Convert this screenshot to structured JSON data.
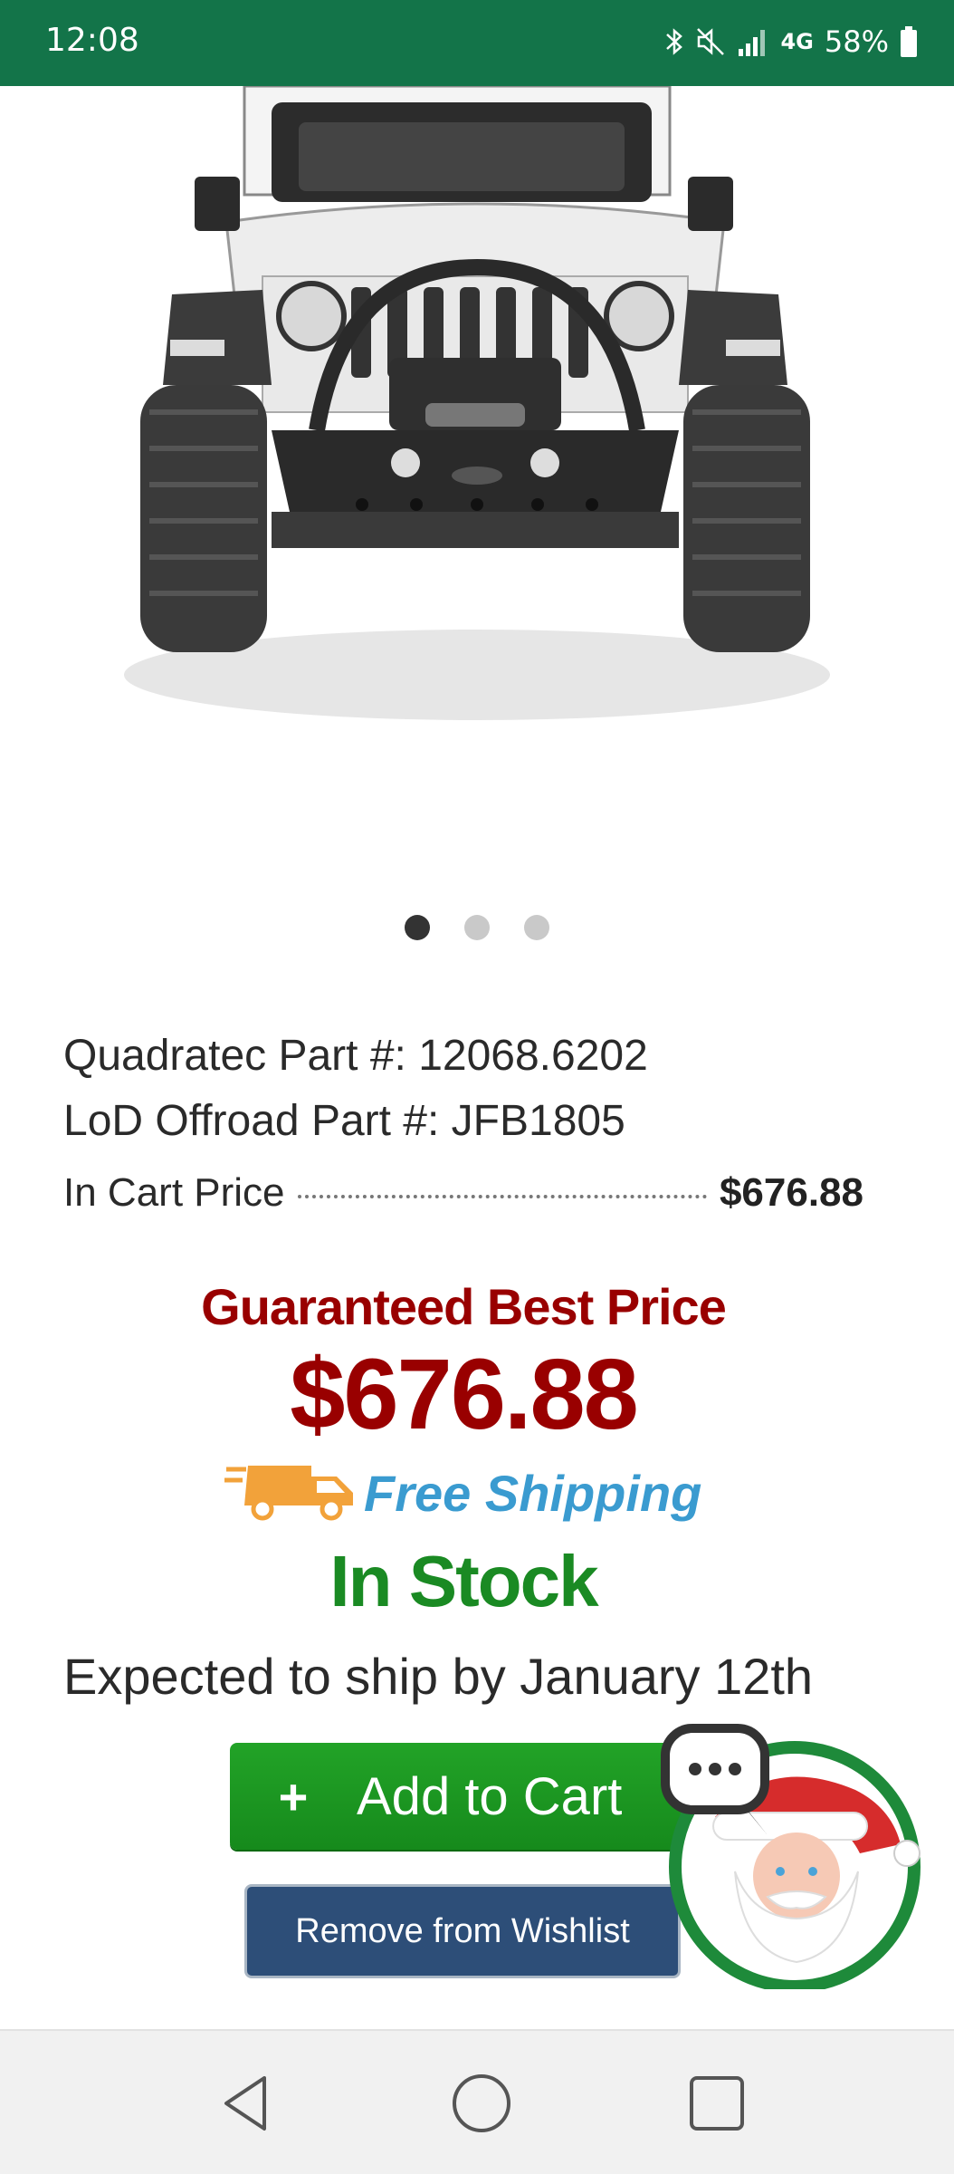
{
  "status_bar": {
    "time": "12:08",
    "network": "4G",
    "battery": "58%",
    "icons": [
      "bluetooth-icon",
      "mute-icon",
      "signal-icon",
      "network-4g-icon",
      "battery-icon"
    ]
  },
  "product": {
    "image_alt": "Jeep with LoD Offroad stinger front bumper",
    "carousel": {
      "count": 3,
      "active": 1
    },
    "quadratec_part": "Quadratec Part #: 12068.6202",
    "brand_part": "LoD Offroad Part #: JFB1805",
    "in_cart_label": "In Cart Price",
    "in_cart_price": "$676.88"
  },
  "offer": {
    "title": "Guaranteed Best Price",
    "price": "$676.88",
    "shipping": "Free Shipping",
    "stock": "In Stock",
    "ship_date": "Expected to ship by January 12th"
  },
  "actions": {
    "add_to_cart_icon": "+",
    "add_to_cart": "Add to Cart",
    "remove_wishlist": "Remove from Wishlist"
  },
  "colors": {
    "status_bar": "#137449",
    "offer_red": "#990000",
    "stock_green": "#1a8a23",
    "shipping_blue": "#3a9bd0",
    "cart_button": "#1f9b24",
    "wishlist_button": "#2d4e78"
  }
}
